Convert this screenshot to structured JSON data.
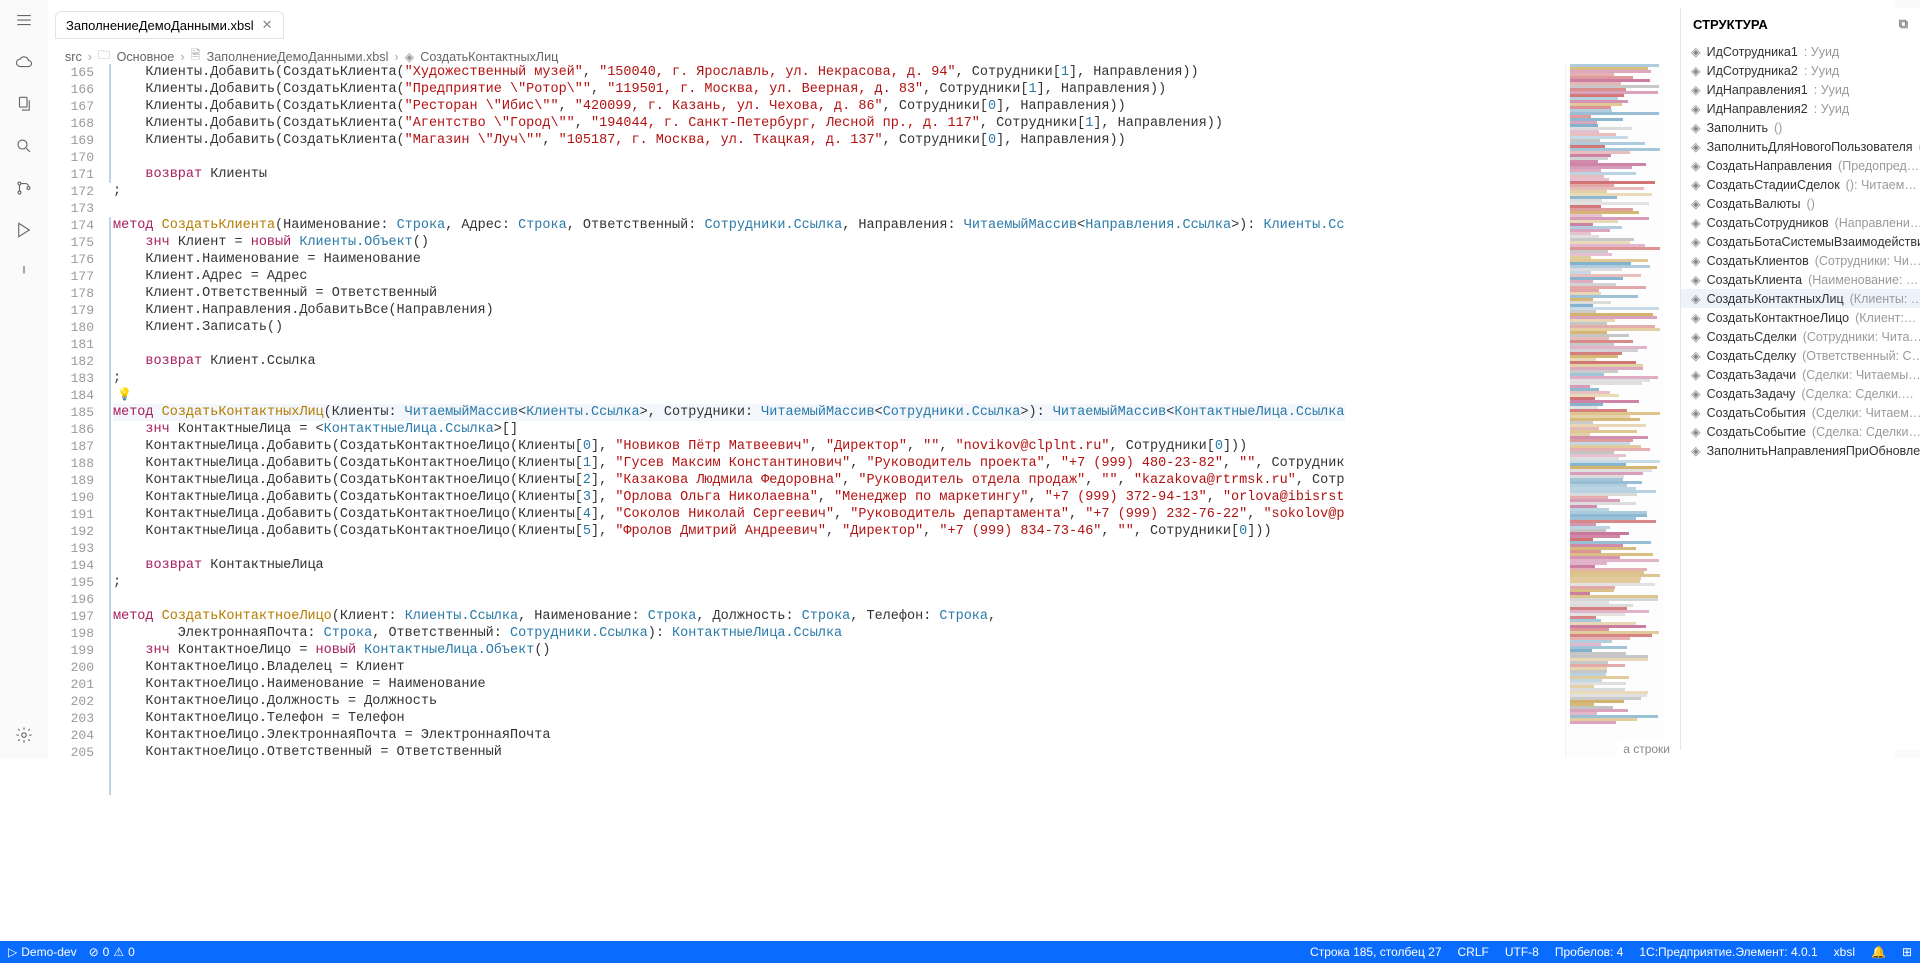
{
  "tab": {
    "name": "ЗаполнениеДемоДанными.xbsl"
  },
  "breadcrumbs": [
    "src",
    "Основное",
    "ЗаполнениеДемоДанными.xbsl",
    "СоздатьКонтактныхЛиц"
  ],
  "structure": {
    "title": "СТРУКТУРА",
    "items": [
      {
        "name": "ИдСотрудника1",
        "meta": ": Ууид"
      },
      {
        "name": "ИдСотрудника2",
        "meta": ": Ууид"
      },
      {
        "name": "ИдНаправления1",
        "meta": ": Ууид"
      },
      {
        "name": "ИдНаправления2",
        "meta": ": Ууид"
      },
      {
        "name": "Заполнить",
        "meta": "()"
      },
      {
        "name": "ЗаполнитьДляНовогоПользователя",
        "meta": "(…"
      },
      {
        "name": "СоздатьНаправления",
        "meta": "(Предопред…"
      },
      {
        "name": "СоздатьСтадииСделок",
        "meta": "(): Читаем…"
      },
      {
        "name": "СоздатьВалюты",
        "meta": "()"
      },
      {
        "name": "СоздатьСотрудников",
        "meta": "(Направлени…"
      },
      {
        "name": "СоздатьБотаСистемыВзаимодействия",
        "meta": ""
      },
      {
        "name": "СоздатьКлиентов",
        "meta": "(Сотрудники: Чи…"
      },
      {
        "name": "СоздатьКлиента",
        "meta": "(Наименование: …"
      },
      {
        "name": "СоздатьКонтактныхЛиц",
        "meta": "(Клиенты: …",
        "sel": true
      },
      {
        "name": "СоздатьКонтактноеЛицо",
        "meta": "(Клиент:…"
      },
      {
        "name": "СоздатьСделки",
        "meta": "(Сотрудники: Чита…"
      },
      {
        "name": "СоздатьСделку",
        "meta": "(Ответственный: С…"
      },
      {
        "name": "СоздатьЗадачи",
        "meta": "(Сделки: Читаемы…"
      },
      {
        "name": "СоздатьЗадачу",
        "meta": "(Сделка: Сделки.…"
      },
      {
        "name": "СоздатьСобытия",
        "meta": "(Сделки: Читаем…"
      },
      {
        "name": "СоздатьСобытие",
        "meta": "(Сделка: Сделки…"
      },
      {
        "name": "ЗаполнитьНаправленияПриОбновлен",
        "meta": ""
      }
    ]
  },
  "rowhint": "а строки",
  "status": {
    "branch": "Demo-dev",
    "errs": "0",
    "warns": "0",
    "pos": "Строка 185, столбец 27",
    "crlf": "CRLF",
    "enc": "UTF-8",
    "spaces": "Пробелов: 4",
    "platform": "1С:Предприятие.Элемент: 4.0.1",
    "lang": "xbsl"
  },
  "lines": {
    "start": 165,
    "code": [
      "    Клиенты.Добавить(СоздатьКлиента(<s>\"Художественный музей\"</s>, <s>\"150040, г. Ярославль, ул. Некрасова, д. 94\"</s>, Сотрудники[<n>1</n>], Направления))",
      "    Клиенты.Добавить(СоздатьКлиента(<s>\"Предприятие \\\"Ротор\\\"\"</s>, <s>\"119501, г. Москва, ул. Веерная, д. 83\"</s>, Сотрудники[<n>1</n>], Направления))",
      "    Клиенты.Добавить(СоздатьКлиента(<s>\"Ресторан \\\"Ибис\\\"\"</s>, <s>\"420099, г. Казань, ул. Чехова, д. 86\"</s>, Сотрудники[<n>0</n>], Направления))",
      "    Клиенты.Добавить(СоздатьКлиента(<s>\"Агентство \\\"Город\\\"\"</s>, <s>\"194044, г. Санкт-Петербург, Лесной пр., д. 117\"</s>, Сотрудники[<n>1</n>], Направления))",
      "    Клиенты.Добавить(СоздатьКлиента(<s>\"Магазин \\\"Луч\\\"\"</s>, <s>\"105187, г. Москва, ул. Ткацкая, д. 137\"</s>, Сотрудники[<n>0</n>], Направления))",
      "",
      "    <k>возврат</k> Клиенты",
      ";",
      "",
      "<k>метод</k> <m>СоздатьКлиента</m>(Наименование: <t>Строка</t>, Адрес: <t>Строка</t>, Ответственный: <t>Сотрудники.Ссылка</t>, Направления: <t>ЧитаемыйМассив</t>&lt;<t>Направления.Ссылка</t>&gt;): <t>Клиенты.Сс</t>",
      "    <k>знч</k> Клиент = <k>новый</k> <t>Клиенты.Объект</t>()",
      "    Клиент.Наименование = Наименование",
      "    Клиент.Адрес = Адрес",
      "    Клиент.Ответственный = Ответственный",
      "    Клиент.Направления.ДобавитьВсе(Направления)",
      "    Клиент.Записать()",
      "",
      "    <k>возврат</k> Клиент.Ссылка",
      ";",
      "",
      "<k>метод</k> <m>СоздатьКонтактныхЛиц</m>(Клиенты: <t>ЧитаемыйМассив</t>&lt;<t>Клиенты.Ссылка</t>&gt;, Сотрудники: <t>ЧитаемыйМассив</t>&lt;<t>Сотрудники.Ссылка</t>&gt;): <t>ЧитаемыйМассив</t>&lt;<t>КонтактныеЛица.Ссылка</t>",
      "    <k>знч</k> КонтактныеЛица = &lt;<t>КонтактныеЛица.Ссылка</t>&gt;[]",
      "    КонтактныеЛица.Добавить(СоздатьКонтактноеЛицо(Клиенты[<n>0</n>], <s>\"Новиков Пётр Матвеевич\"</s>, <s>\"Директор\"</s>, <s>\"\"</s>, <s>\"novikov@clplnt.ru\"</s>, Сотрудники[<n>0</n>]))",
      "    КонтактныеЛица.Добавить(СоздатьКонтактноеЛицо(Клиенты[<n>1</n>], <s>\"Гусев Максим Константинович\"</s>, <s>\"Руководитель проекта\"</s>, <s>\"+7 (999) 480-23-82\"</s>, <s>\"\"</s>, Сотрудник",
      "    КонтактныеЛица.Добавить(СоздатьКонтактноеЛицо(Клиенты[<n>2</n>], <s>\"Казакова Людмила Федоровна\"</s>, <s>\"Руководитель отдела продаж\"</s>, <s>\"\"</s>, <s>\"kazakova@rtrmsk.ru\"</s>, Сотр",
      "    КонтактныеЛица.Добавить(СоздатьКонтактноеЛицо(Клиенты[<n>3</n>], <s>\"Орлова Ольга Николаевна\"</s>, <s>\"Менеджер по маркетингу\"</s>, <s>\"+7 (999) 372-94-13\"</s>, <s>\"orlova@ibisrst</s>",
      "    КонтактныеЛица.Добавить(СоздатьКонтактноеЛицо(Клиенты[<n>4</n>], <s>\"Соколов Николай Сергеевич\"</s>, <s>\"Руководитель департамента\"</s>, <s>\"+7 (999) 232-76-22\"</s>, <s>\"sokolov@p</s>",
      "    КонтактныеЛица.Добавить(СоздатьКонтактноеЛицо(Клиенты[<n>5</n>], <s>\"Фролов Дмитрий Андреевич\"</s>, <s>\"Директор\"</s>, <s>\"+7 (999) 834-73-46\"</s>, <s>\"\"</s>, Сотрудники[<n>0</n>]))",
      "",
      "    <k>возврат</k> КонтактныеЛица",
      ";",
      "",
      "<k>метод</k> <m>СоздатьКонтактноеЛицо</m>(Клиент: <t>Клиенты.Ссылка</t>, Наименование: <t>Строка</t>, Должность: <t>Строка</t>, Телефон: <t>Строка</t>,",
      "        ЭлектроннаяПочта: <t>Строка</t>, Ответственный: <t>Сотрудники.Ссылка</t>): <t>КонтактныеЛица.Ссылка</t>",
      "    <k>знч</k> КонтактноеЛицо = <k>новый</k> <t>КонтактныеЛица.Объект</t>()",
      "    КонтактноеЛицо.Владелец = Клиент",
      "    КонтактноеЛицо.Наименование = Наименование",
      "    КонтактноеЛицо.Должность = Должность",
      "    КонтактноеЛицо.Телефон = Телефон",
      "    КонтактноеЛицо.ЭлектроннаяПочта = ЭлектроннаяПочта",
      "    КонтактноеЛицо.Ответственный = Ответственный"
    ]
  }
}
